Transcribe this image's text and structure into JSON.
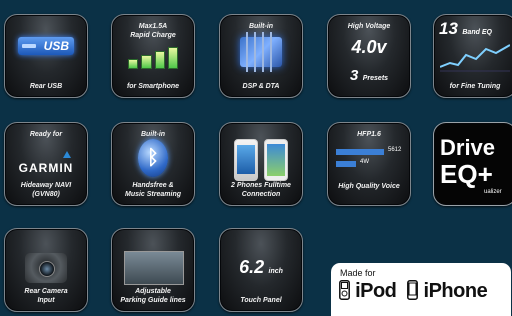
{
  "tiles": {
    "usb": {
      "art": "USB",
      "bottom": "Rear USB"
    },
    "charge": {
      "top": "Max1.5A\nRapid Charge",
      "bottom": "for Smartphone"
    },
    "dsp": {
      "top": "Built-in",
      "bottom": "DSP & DTA"
    },
    "voltage": {
      "top": "High Voltage",
      "value": "4.0v",
      "presets_num": "3",
      "presets_label": "Presets"
    },
    "eq": {
      "num": "13",
      "label": "Band EQ",
      "bottom": "for Fine Tuning"
    },
    "garmin": {
      "top": "Ready for",
      "brand": "GARMIN",
      "bottom": "Hideaway NAVI\n(GVN80)"
    },
    "bluetooth": {
      "top": "Built-in",
      "bottom": "Handsfree &\nMusic Streaming"
    },
    "phones": {
      "bottom": "2 Phones Fulltime\nConnection"
    },
    "hfp": {
      "top": "HFP1.6",
      "line1": "5612",
      "line2": "4W",
      "bottom": "High Quality Voice"
    },
    "drive_eq": {
      "line1": "Drive",
      "line2": "EQ+",
      "small": "ualizer"
    },
    "camera": {
      "bottom": "Rear Camera\nInput"
    },
    "parking": {
      "bottom": "Adjustable\nParking Guide lines"
    },
    "touch": {
      "value": "6.2",
      "unit": "inch",
      "bottom": "Touch Panel"
    }
  },
  "badge": {
    "made_for": "Made for",
    "ipod": "iPod",
    "iphone": "iPhone"
  }
}
